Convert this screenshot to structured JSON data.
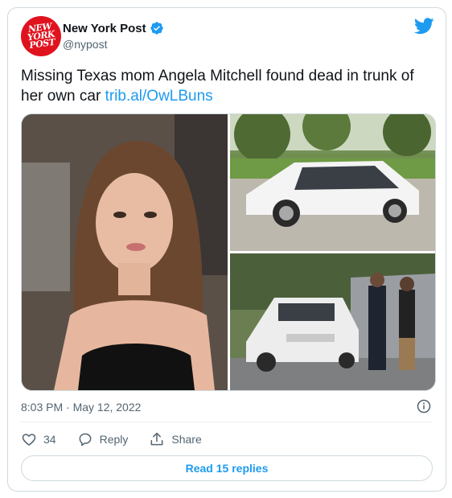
{
  "author": {
    "name": "New York Post",
    "handle": "@nypost",
    "avatar_logo_lines": [
      "NEW",
      "YORK",
      "POST"
    ],
    "brand_color": "#e0121e"
  },
  "tweet": {
    "text": "Missing Texas mom Angela Mitchell found dead in trunk of her own car ",
    "link": "trib.al/OwLBuns",
    "link_color": "#1d9bf0",
    "timestamp": "8:03 PM · May 12, 2022"
  },
  "media": [
    {
      "name": "photo-woman-selfie"
    },
    {
      "name": "photo-white-sedan"
    },
    {
      "name": "photo-police-scene"
    }
  ],
  "actions": {
    "like_count": "34",
    "reply_label": "Reply",
    "share_label": "Share"
  },
  "read_replies_label": "Read 15 replies",
  "icons": [
    "verified-icon",
    "twitter-bird-icon",
    "info-icon",
    "heart-icon",
    "reply-icon",
    "share-icon"
  ]
}
